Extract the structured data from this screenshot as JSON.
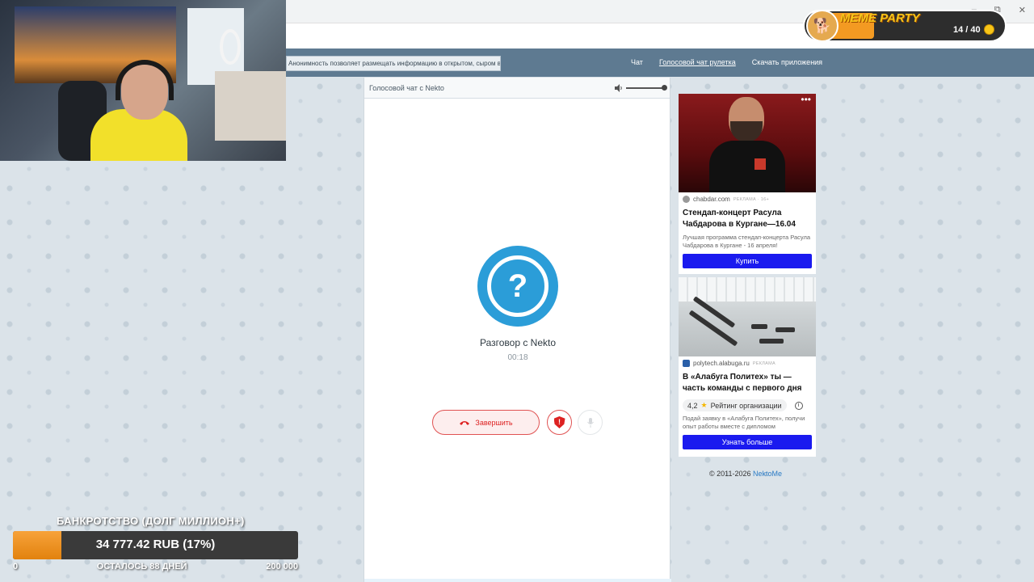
{
  "browser": {
    "minimize": "–",
    "restore": "⧉",
    "close": "✕",
    "menu": "⋮"
  },
  "site": {
    "notice": "Анонимность позволяет размещать информацию в открытом, сыром виде!",
    "nav": [
      "Чат",
      "Голосовой чат рулетка",
      "Скачать приложения"
    ],
    "nav_active_index": 1
  },
  "chat": {
    "header_title": "Голосовой чат с Nekto",
    "avatar_symbol": "?",
    "conversation_title": "Разговор с Nekto",
    "timer": "00:18",
    "end_button": "Завершить",
    "report_symbol": "!",
    "volume_level": 1.0
  },
  "ads": [
    {
      "source": "chabdar.com",
      "tag": "РЕКЛАМА · 16+",
      "title": "Стендап-концерт Расула Чабдарова в Кургане—16.04",
      "description": "Лучшая программа стендап-концерта Расула Чабдарова в Кургане - 16 апреля!",
      "button": "Купить",
      "menu": "•••"
    },
    {
      "source": "polytech.alabuga.ru",
      "tag": "РЕКЛАМА",
      "title": "В «Алабуга Политех» ты — часть команды с первого дня",
      "rating_value": "4,2",
      "rating_label": "Рейтинг организации",
      "description": "Подай заявку в «Алабуга Политех», получи опыт работы вместе с дипломом",
      "button": "Узнать больше"
    }
  ],
  "footer": {
    "copyright": "© 2011-2026 ",
    "link": "NektoMe"
  },
  "meme_party": {
    "title": "MEME PARTY",
    "count": "14 / 40"
  },
  "bankruptcy": {
    "title": "БАНКРОТСТВО (ДОЛГ МИЛЛИОН+)",
    "value": "34 777.42 RUB (17%)",
    "progress": 0.17,
    "min": "0",
    "days_left": "ОСТАЛОСЬ 88 ДНЕЙ",
    "max": "200 000"
  },
  "colors": {
    "accent_blue": "#2b9dd8",
    "navbar": "#5e7a91",
    "end_red": "#dd2222",
    "ad_button": "#1a1aef",
    "progress_orange": "#f39a22"
  }
}
